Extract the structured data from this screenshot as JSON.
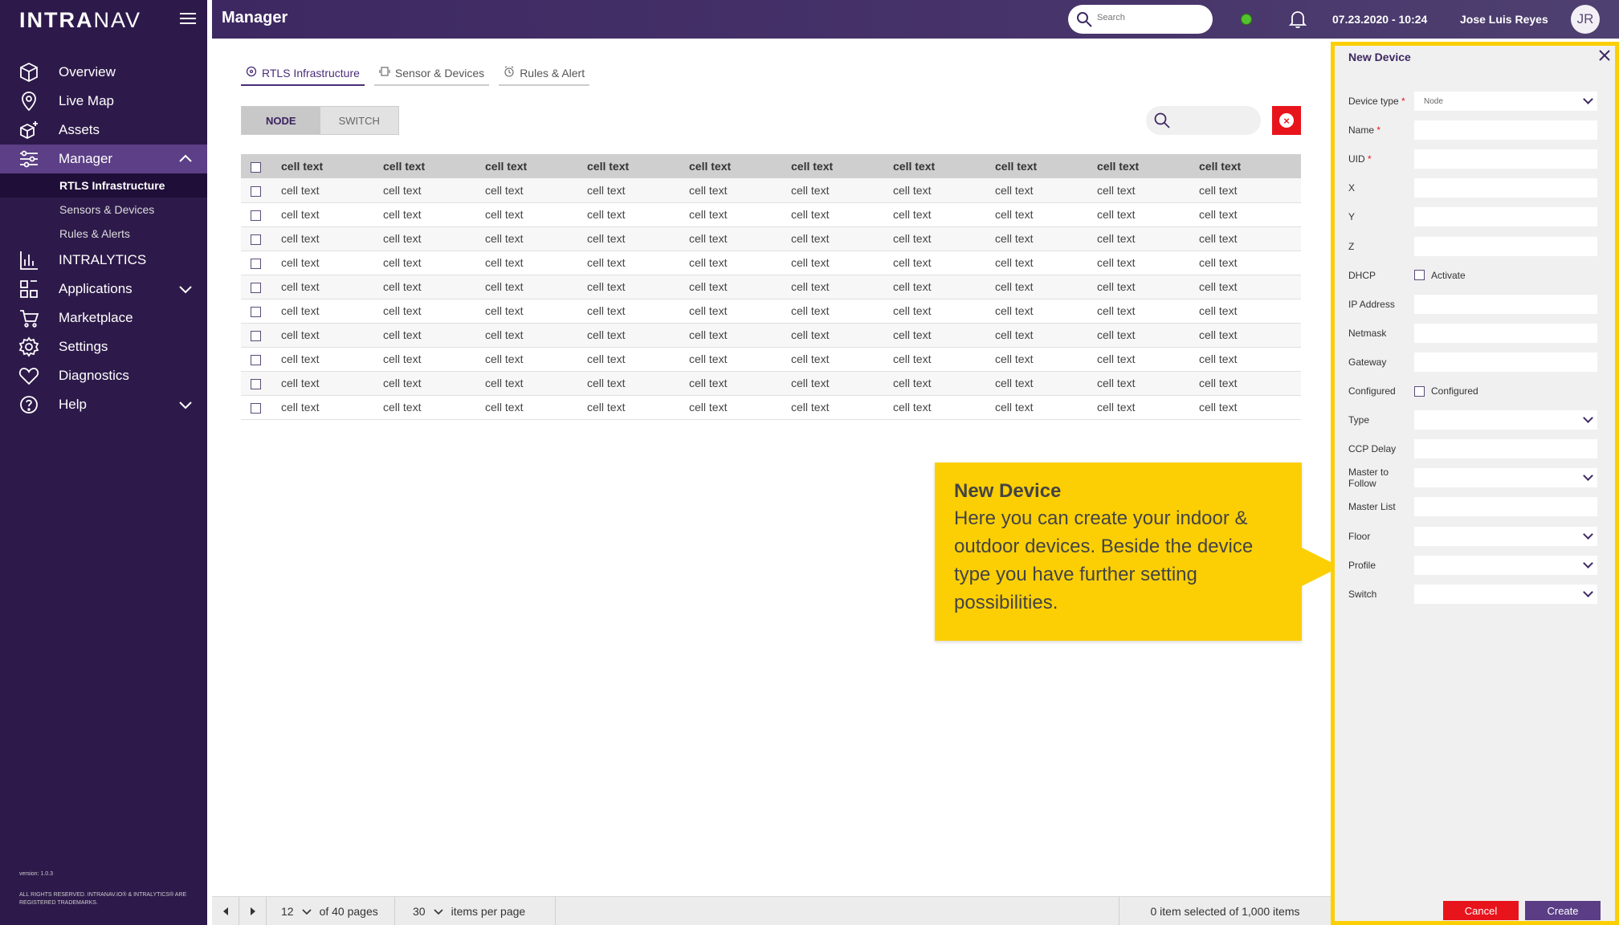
{
  "app": {
    "logo_prefix": "INTRA",
    "logo_suffix": "NAV",
    "version": "version: 1.0.3",
    "copyright": "ALL RIGHTS RESERVED. INTRANAV.IO® & INTRALYTICS® ARE REGISTERED TRADEMARKS."
  },
  "sidebar": {
    "items": [
      {
        "label": "Overview",
        "icon": "cube-icon"
      },
      {
        "label": "Live Map",
        "icon": "map-pin-icon"
      },
      {
        "label": "Assets",
        "icon": "box-plus-icon"
      },
      {
        "label": "Manager",
        "icon": "sliders-icon"
      },
      {
        "label": "INTRALYTICS",
        "icon": "bar-chart-icon"
      },
      {
        "label": "Applications",
        "icon": "apps-icon"
      },
      {
        "label": "Marketplace",
        "icon": "cart-icon"
      },
      {
        "label": "Settings",
        "icon": "gear-icon"
      },
      {
        "label": "Diagnostics",
        "icon": "heart-icon"
      },
      {
        "label": "Help",
        "icon": "help-icon"
      }
    ],
    "manager_sub": [
      "RTLS Infrastructure",
      "Sensors & Devices",
      "Rules & Alerts"
    ]
  },
  "header": {
    "title": "Manager",
    "search_placeholder": "Search",
    "datetime": "07.23.2020 - 10:24",
    "user_name": "Jose Luis Reyes",
    "user_initials": "JR"
  },
  "tabs": [
    "RTLS Infrastructure",
    "Sensor & Devices",
    "Rules & Alert"
  ],
  "toggle": {
    "node": "NODE",
    "switch": "SWITCH"
  },
  "table": {
    "headers": [
      "cell text",
      "cell text",
      "cell text",
      "cell text",
      "cell text",
      "cell text",
      "cell text",
      "cell text",
      "cell text",
      "cell text"
    ],
    "row_count": 10,
    "cell": "cell text"
  },
  "callout": {
    "title": "New Device",
    "body": "Here you can create your indoor & outdoor devices. Beside the device type you have further setting possibilities."
  },
  "panel": {
    "title": "New Device",
    "fields": [
      {
        "label": "Device type",
        "required": true,
        "kind": "dropdown",
        "value": "Node"
      },
      {
        "label": "Name",
        "required": true,
        "kind": "text",
        "value": ""
      },
      {
        "label": "UID",
        "required": true,
        "kind": "text",
        "value": ""
      },
      {
        "label": "X",
        "required": false,
        "kind": "text",
        "value": ""
      },
      {
        "label": "Y",
        "required": false,
        "kind": "text",
        "value": ""
      },
      {
        "label": "Z",
        "required": false,
        "kind": "text",
        "value": ""
      },
      {
        "label": "DHCP",
        "required": false,
        "kind": "checkbox",
        "value": "Activate"
      },
      {
        "label": "IP Address",
        "required": false,
        "kind": "text",
        "value": ""
      },
      {
        "label": "Netmask",
        "required": false,
        "kind": "text",
        "value": ""
      },
      {
        "label": "Gateway",
        "required": false,
        "kind": "text",
        "value": ""
      },
      {
        "label": "Configured",
        "required": false,
        "kind": "checkbox",
        "value": "Configured"
      },
      {
        "label": "Type",
        "required": false,
        "kind": "dropdown",
        "value": ""
      },
      {
        "label": "CCP Delay",
        "required": false,
        "kind": "text",
        "value": ""
      },
      {
        "label": "Master to Follow",
        "required": false,
        "kind": "dropdown",
        "value": ""
      },
      {
        "label": "Master List",
        "required": false,
        "kind": "text",
        "value": ""
      },
      {
        "label": "Floor",
        "required": false,
        "kind": "dropdown",
        "value": ""
      },
      {
        "label": "Profile",
        "required": false,
        "kind": "dropdown",
        "value": ""
      },
      {
        "label": "Switch",
        "required": false,
        "kind": "dropdown",
        "value": ""
      }
    ],
    "cancel": "Cancel",
    "create": "Create"
  },
  "pager": {
    "page": "12",
    "of_pages": "of 40 pages",
    "per_page": "30",
    "per_page_label": "items per page",
    "selection": "0 item selected of 1,000 items"
  },
  "colors": {
    "sidebar": "#2d1a4a",
    "accent": "#4a2d78",
    "callout": "#fccf05",
    "danger": "#e8141c",
    "online": "#53c22b"
  }
}
